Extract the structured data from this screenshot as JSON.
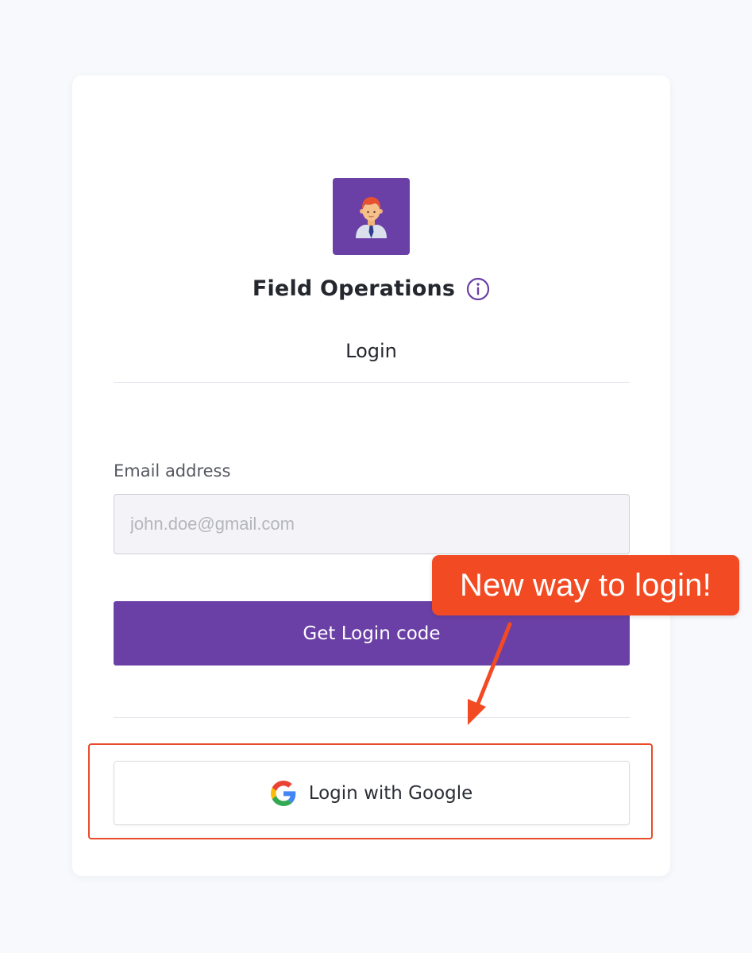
{
  "app": {
    "title": "Field Operations",
    "logo_icon": "user-avatar-icon",
    "info_icon": "info-icon"
  },
  "tabs": {
    "login_label": "Login"
  },
  "form": {
    "email_label": "Email address",
    "email_placeholder": "john.doe@gmail.com",
    "email_value": "",
    "submit_label": "Get Login code"
  },
  "google": {
    "label": "Login with Google",
    "icon": "google-icon"
  },
  "annotation": {
    "callout_text": "New way to login!"
  },
  "colors": {
    "brand": "#6a40a6",
    "annotation": "#f24b23",
    "background": "#f8f9fc"
  }
}
